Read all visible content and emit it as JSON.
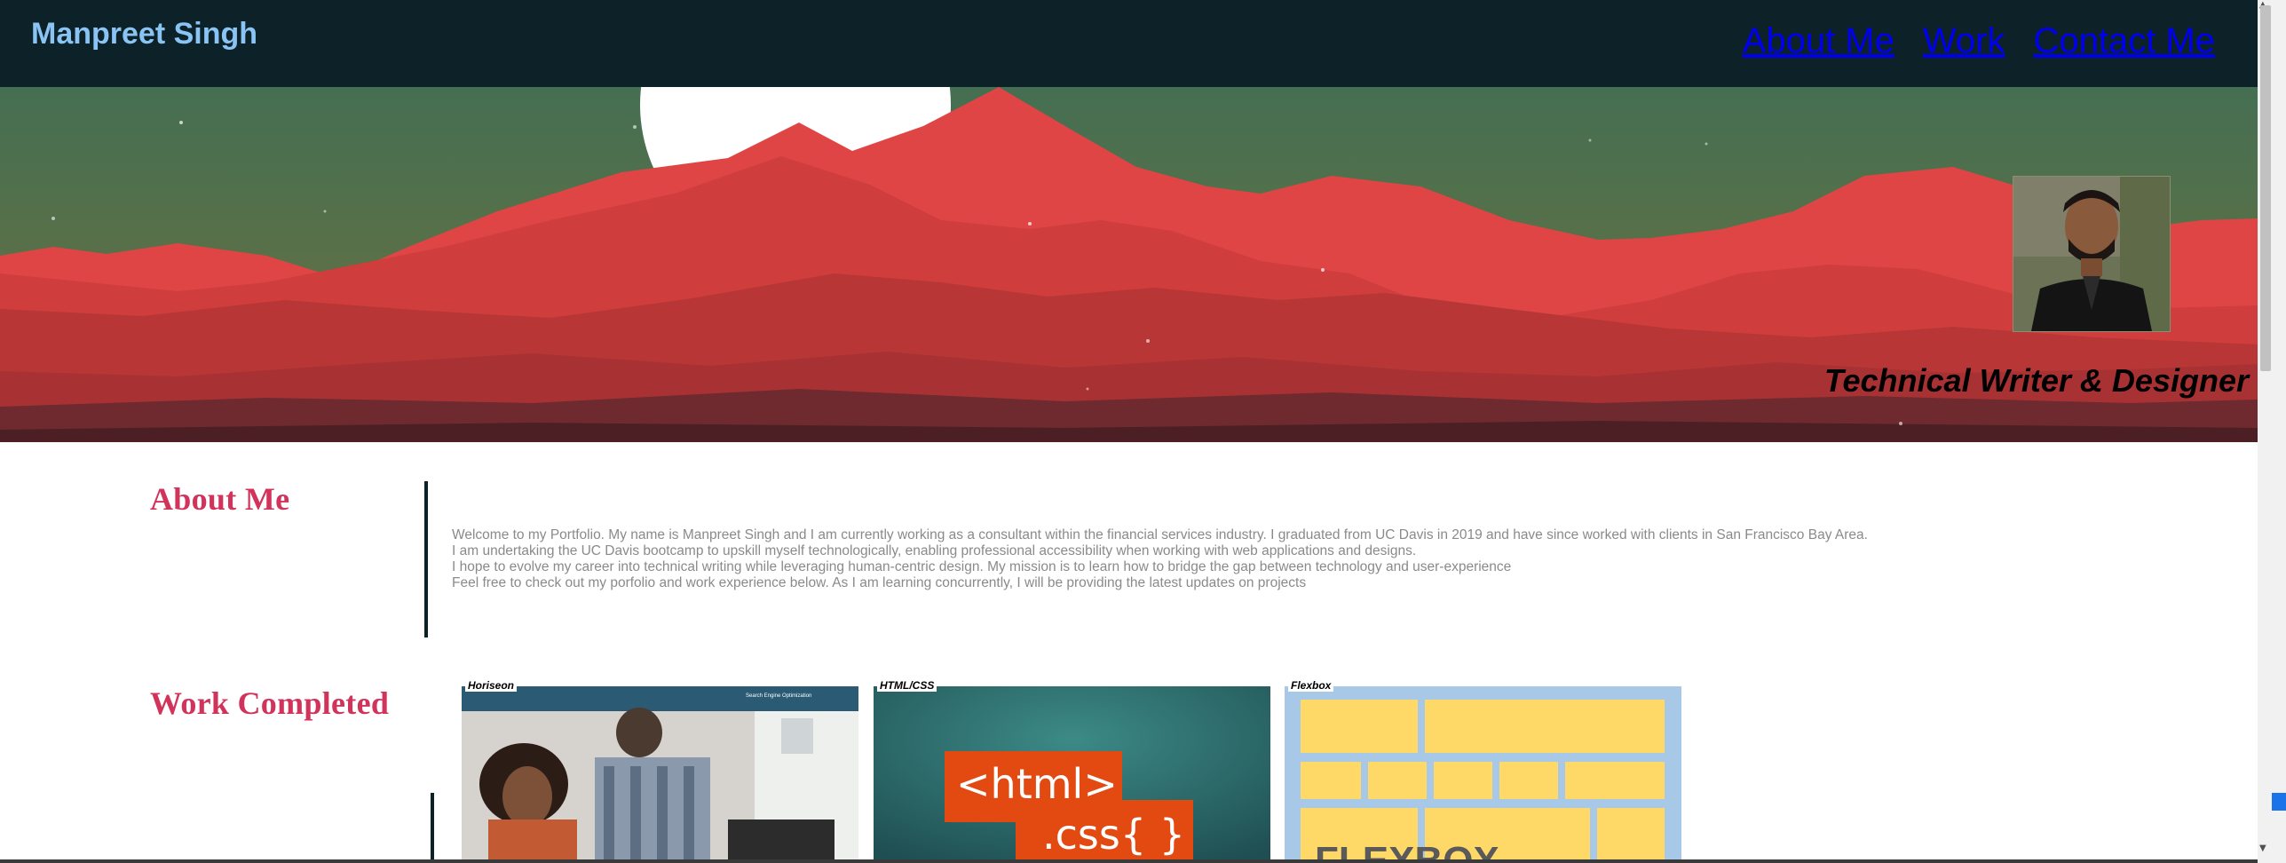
{
  "header": {
    "brand": "Manpreet Singh",
    "nav": [
      "About Me",
      "Work",
      "Contact Me"
    ]
  },
  "hero": {
    "tagline": "Technical Writer & Designer"
  },
  "about": {
    "title": "About Me",
    "paragraphs": [
      "Welcome to my Portfolio. My name is Manpreet Singh and I am currently working as a consultant within the financial services industry. I graduated from UC Davis in 2019 and have since worked with clients in San Francisco Bay Area.",
      "I am undertaking the UC Davis bootcamp to upskill myself technologically, enabling professional accessibility when working with web applications and designs.",
      "I hope to evolve my career into technical writing while leveraging human-centric design. My mission is to learn how to bridge the gap between technology and user-experience",
      "Feel free to check out my porfolio and work experience below. As I am learning concurrently, I will be providing the latest updates on projects"
    ]
  },
  "work": {
    "title": "Work Completed",
    "projects": [
      {
        "label": "Horiseon",
        "thumb_text": "Search Engine Optimization"
      },
      {
        "label": "HTML/CSS",
        "thumb_text_1": "<html>",
        "thumb_text_2": ".css{ }"
      },
      {
        "label": "Flexbox",
        "thumb_text": "FLEXBOX"
      }
    ]
  },
  "colors": {
    "header_bg": "#0d2228",
    "brand": "#89c4f4",
    "section_title": "#d1335b",
    "hero_sky": "#4a7150",
    "mountain": "#e04545"
  }
}
